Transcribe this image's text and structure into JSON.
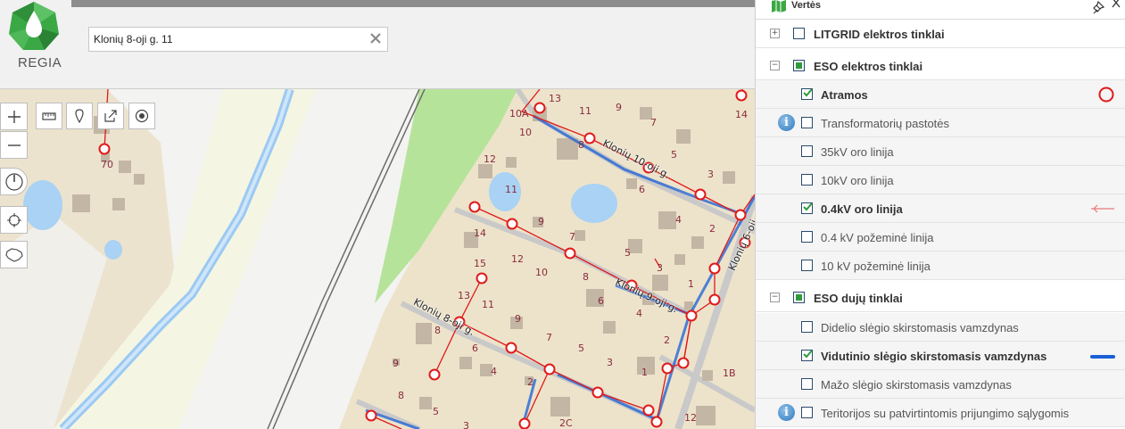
{
  "app": {
    "logo_text": "REGIA"
  },
  "search": {
    "value": "Klonių 8-oji g. 11",
    "placeholder": ""
  },
  "map_tools": [
    {
      "name": "zoom-in-button",
      "icon": "plus-icon"
    },
    {
      "name": "zoom-out-button",
      "icon": "minus-icon"
    },
    {
      "name": "measure-distance-button",
      "icon": "ruler-icon"
    },
    {
      "name": "place-marker-button",
      "icon": "pin-icon"
    },
    {
      "name": "share-button",
      "icon": "share-icon"
    },
    {
      "name": "target-button",
      "icon": "target-icon"
    },
    {
      "name": "compass-button",
      "icon": "compass-icon"
    },
    {
      "name": "locate-button",
      "icon": "crosshair-icon"
    },
    {
      "name": "lithuania-extent-button",
      "icon": "country-outline-icon"
    }
  ],
  "map": {
    "streets": [
      {
        "label": "Klonių 10-oji g."
      },
      {
        "label": "Klonių 9-oji g."
      },
      {
        "label": "Klonių 8-oji g."
      },
      {
        "label": "Klonių 6-oji g."
      }
    ],
    "house_numbers": [
      "70",
      "13",
      "10A",
      "11",
      "9",
      "7",
      "10",
      "8",
      "5",
      "3",
      "14",
      "12",
      "11",
      "6",
      "4",
      "2",
      "9",
      "7",
      "14",
      "12",
      "10",
      "5",
      "3",
      "15",
      "8",
      "1",
      "13",
      "11",
      "6",
      "4",
      "9",
      "7",
      "8",
      "5",
      "2",
      "6",
      "3",
      "9",
      "4",
      "2",
      "1",
      "1B",
      "8",
      "5",
      "3",
      "2C",
      "12",
      "14"
    ]
  },
  "panel": {
    "title": "Vertės",
    "pin_icon": "pin-icon",
    "close_icon": "close-icon",
    "groups": [
      {
        "label": "LITGRID elektros tinklai",
        "expander": "+",
        "checked": false,
        "partial": false
      },
      {
        "label": "ESO elektros tinklai",
        "expander": "−",
        "checked": false,
        "partial": true
      },
      {
        "label": "ESO dujų tinklai",
        "expander": "−",
        "checked": false,
        "partial": true
      }
    ],
    "layers": [
      {
        "label": "Atramos",
        "checked": true,
        "legend": "red-circle-icon",
        "info": false
      },
      {
        "label": "Transformatorių pastotės",
        "checked": false,
        "info": true
      },
      {
        "label": "35kV oro linija",
        "checked": false,
        "info": false
      },
      {
        "label": "10kV oro linija",
        "checked": false,
        "info": false
      },
      {
        "label": "0.4kV oro linija",
        "checked": true,
        "legend": "red-line-icon",
        "info": false
      },
      {
        "label": "0.4 kV požeminė linija",
        "checked": false,
        "info": false
      },
      {
        "label": "10 kV požeminė linija",
        "checked": false,
        "info": false
      },
      {
        "label": "Didelio slėgio skirstomasis vamzdynas",
        "checked": false,
        "info": false
      },
      {
        "label": "Vidutinio slėgio skirstomasis vamzdynas",
        "checked": true,
        "legend": "blue-line-icon",
        "info": false
      },
      {
        "label": "Mažo slėgio skirstomasis vamzdynas",
        "checked": false,
        "info": false
      },
      {
        "label": "Teritorijos su patvirtintomis prijungimo sąlygomis",
        "checked": false,
        "info": true
      }
    ],
    "info_glyph": "i"
  },
  "colors": {
    "power_line": "#e01a1a",
    "gas_pipe": "#1a5fd6",
    "checkbox_mark": "#2d9c3c",
    "brand_green": "#3aa845"
  }
}
